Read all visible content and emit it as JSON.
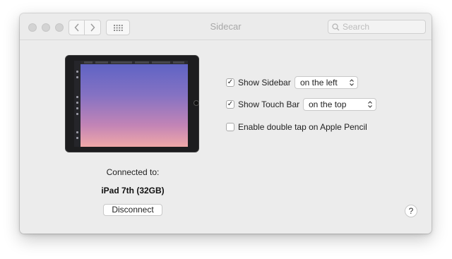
{
  "window": {
    "title": "Sidecar"
  },
  "toolbar": {
    "search_placeholder": "Search"
  },
  "device": {
    "connected_label": "Connected to:",
    "name": "iPad 7th (32GB)",
    "disconnect_label": "Disconnect"
  },
  "options": {
    "show_sidebar": {
      "label": "Show Sidebar",
      "checked": true,
      "value": "on the left"
    },
    "show_touch_bar": {
      "label": "Show Touch Bar",
      "checked": true,
      "value": "on the top"
    },
    "double_tap": {
      "label": "Enable double tap on Apple Pencil",
      "checked": false
    }
  },
  "help": {
    "label": "?"
  },
  "icons": {
    "back": "chevron-left-icon",
    "forward": "chevron-right-icon",
    "grid": "grid-icon",
    "search": "search-icon",
    "popup": "chevron-updown-icon"
  },
  "colors": {
    "window_bg": "#ececec",
    "accent": "#222222"
  }
}
